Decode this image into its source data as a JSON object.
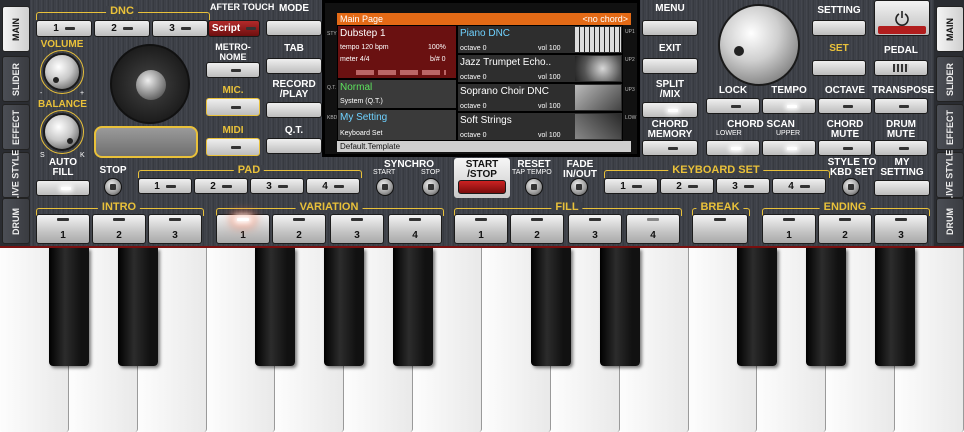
{
  "side_tabs_left": [
    "MAIN",
    "SLIDER",
    "EFFECT",
    "LIVE STYLE",
    "DRUM"
  ],
  "side_tabs_right": [
    "MAIN",
    "SLIDER",
    "EFFECT",
    "LIVE STYLE",
    "DRUM"
  ],
  "dnc": {
    "label": "DNC",
    "buttons": [
      "1",
      "2",
      "3"
    ],
    "after_touch": "AFTER TOUCH",
    "script": "Script"
  },
  "volume": "VOLUME",
  "balance": "BALANCE",
  "balance_s": "S",
  "balance_k": "K",
  "minus": "-",
  "plus": "+",
  "metronome": "METRO-\nNOME",
  "mic": "MIC.",
  "midi": "MIDI",
  "left_col": {
    "mode": "MODE",
    "tab": "TAB",
    "record": "RECORD\n/PLAY",
    "qt": "Q.T."
  },
  "screen": {
    "title": "Main Page",
    "chord": "<no chord>",
    "style": {
      "name": "Dubstep 1",
      "tempo": "tempo 120 bpm",
      "percent": "100%",
      "meter": "meter 4/4",
      "bsharp": "b/#  0"
    },
    "variation": {
      "name": "Normal",
      "sub": "System (Q.T.)"
    },
    "setting": {
      "name": "My Setting",
      "sub": "Keyboard Set"
    },
    "parts": [
      {
        "name": "Piano DNC",
        "octave": "octave  0",
        "vol": "vol 100",
        "tag": "UP1"
      },
      {
        "name": "Jazz Trumpet Echo..",
        "octave": "octave  0",
        "vol": "vol 100",
        "tag": "UP2"
      },
      {
        "name": "Soprano Choir DNC",
        "octave": "octave  0",
        "vol": "vol 100",
        "tag": "UP3"
      },
      {
        "name": "Soft Strings",
        "octave": "octave  0",
        "vol": "vol 100",
        "tag": "LOW"
      }
    ],
    "side_left": [
      "STYLE",
      "Q.T.",
      "KBD"
    ],
    "footer": "Default.Template"
  },
  "right_col": {
    "menu": "MENU",
    "exit": "EXIT",
    "split": "SPLIT\n/MIX",
    "chord_memory": "CHORD\nMEMORY"
  },
  "setting": "SETTING",
  "set": "SET",
  "pedal": "PEDAL",
  "lock": "LOCK",
  "tempo": "TEMPO",
  "octave": "OCTAVE",
  "transpose": "TRANSPOSE",
  "chord_scan": "CHORD SCAN",
  "lower": "LOWER",
  "upper": "UPPER",
  "chord_mute": "CHORD\nMUTE",
  "drum_mute": "DRUM\nMUTE",
  "auto_fill": "AUTO\nFILL",
  "stop": "STOP",
  "pad": {
    "label": "PAD",
    "buttons": [
      "1",
      "2",
      "3",
      "4"
    ]
  },
  "synchro": {
    "label": "SYNCHRO",
    "start": "START",
    "stop": "STOP"
  },
  "start_stop": "START\n/STOP",
  "reset": "RESET",
  "tap_tempo": "TAP TEMPO",
  "fade": "FADE\nIN/OUT",
  "keyboard_set": {
    "label": "KEYBOARD SET",
    "buttons": [
      "1",
      "2",
      "3",
      "4"
    ]
  },
  "style_to_kbd": "STYLE TO\nKBD SET",
  "my_setting": "MY\nSETTING",
  "intro": {
    "label": "INTRO",
    "buttons": [
      "1",
      "2",
      "3"
    ]
  },
  "variation": {
    "label": "VARIATION",
    "buttons": [
      "1",
      "2",
      "3",
      "4"
    ]
  },
  "fill": {
    "label": "FILL",
    "buttons": [
      "1",
      "2",
      "3",
      "4"
    ]
  },
  "break": {
    "label": "BREAK"
  },
  "ending": {
    "label": "ENDING",
    "buttons": [
      "1",
      "2",
      "3"
    ]
  }
}
